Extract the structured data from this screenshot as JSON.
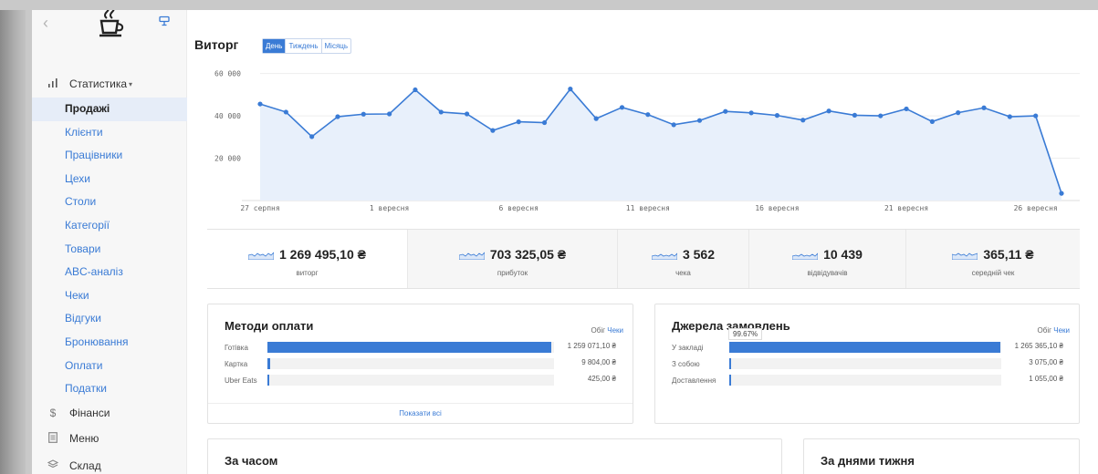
{
  "sidebar": {
    "back_icon": "chevron-left-icon",
    "logo_icon": "coffee-cup-icon",
    "mode_icon": "terminal-icon",
    "statistics_label": "Статистика",
    "statistics_caret": "▾",
    "items": [
      {
        "label": "Продажі"
      },
      {
        "label": "Клієнти"
      },
      {
        "label": "Працівники"
      },
      {
        "label": "Цехи"
      },
      {
        "label": "Столи"
      },
      {
        "label": "Категорії"
      },
      {
        "label": "Товари"
      },
      {
        "label": "ABC-аналіз"
      },
      {
        "label": "Чеки"
      },
      {
        "label": "Відгуки"
      },
      {
        "label": "Бронювання"
      },
      {
        "label": "Оплати"
      },
      {
        "label": "Податки"
      }
    ],
    "finance_label": "Фінанси",
    "finance_symbol": "$",
    "menu_label": "Меню",
    "warehouse_label": "Склад"
  },
  "revenue": {
    "title": "Виторг",
    "periods": [
      "День",
      "Тиждень",
      "Місяць"
    ],
    "active_period": "День"
  },
  "chart_data": {
    "type": "area",
    "title": "",
    "xlabel": "",
    "ylabel": "",
    "ylim": [
      0,
      62000
    ],
    "yticks": [
      "60 000",
      "40 000",
      "20 000"
    ],
    "ytick_values": [
      60000,
      40000,
      20000
    ],
    "xticks": [
      {
        "label": "27 серпня",
        "index": 0
      },
      {
        "label": "1 вересня",
        "index": 5
      },
      {
        "label": "6 вересня",
        "index": 10
      },
      {
        "label": "11 вересня",
        "index": 15
      },
      {
        "label": "16 вересня",
        "index": 20
      },
      {
        "label": "21 вересня",
        "index": 25
      },
      {
        "label": "26 вересня",
        "index": 30
      }
    ],
    "values": [
      45600,
      41800,
      30200,
      39600,
      40800,
      40900,
      52300,
      41800,
      40900,
      33100,
      37200,
      36800,
      52700,
      38700,
      44000,
      40600,
      35800,
      37800,
      42100,
      41400,
      40200,
      38000,
      42300,
      40300,
      40000,
      43300,
      37300,
      41500,
      43800,
      39600,
      40000,
      3400
    ],
    "color": "#3a7bd5",
    "fill": "#e8f0fb"
  },
  "stats": [
    {
      "value": "1 269 495,10 ₴",
      "label": "виторг"
    },
    {
      "value": "703 325,05 ₴",
      "label": "прибуток"
    },
    {
      "value": "3 562",
      "label": "чека"
    },
    {
      "value": "10 439",
      "label": "відвідувачів"
    },
    {
      "value": "365,11 ₴",
      "label": "середній чек"
    }
  ],
  "payments": {
    "title": "Методи оплати",
    "link_static": "Обіг",
    "link_active": "Чеки",
    "rows": [
      {
        "name": "Готівка",
        "amount": "1 259 071,10 ₴",
        "share": 0.992
      },
      {
        "name": "Картка",
        "amount": "9 804,00 ₴",
        "share": 0.008
      },
      {
        "name": "Uber Eats",
        "amount": "425,00 ₴",
        "share": 0.0003
      }
    ],
    "show_all": "Показати всі"
  },
  "sources": {
    "title": "Джерела замовлень",
    "link_static": "Обіг",
    "link_active": "Чеки",
    "tooltip": "99.67%",
    "rows": [
      {
        "name": "У закладі",
        "amount": "1 265 365,10 ₴",
        "share": 0.9967
      },
      {
        "name": "З собою",
        "amount": "3 075,00 ₴",
        "share": 0.0024
      },
      {
        "name": "Доставлення",
        "amount": "1 055,00 ₴",
        "share": 0.0008
      }
    ]
  },
  "by_time": {
    "title": "За часом"
  },
  "by_weekday": {
    "title": "За днями тижня"
  }
}
